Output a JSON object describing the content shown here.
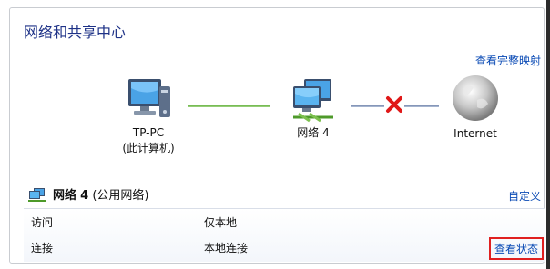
{
  "window": {
    "title": "网络和共享中心"
  },
  "map": {
    "full_map_link": "查看完整映射",
    "nodes": [
      {
        "label_line1": "TP-PC",
        "label_line2": "(此计算机)"
      },
      {
        "label_line1": "网络  4"
      },
      {
        "label_line1": "Internet"
      }
    ],
    "connection_status": {
      "pc_to_network": "connected",
      "network_to_internet": "disconnected"
    }
  },
  "active_network": {
    "name": "网络",
    "number": "4",
    "type": "(公用网络)",
    "customize_link": "自定义",
    "rows": [
      {
        "key": "访问",
        "value": "仅本地"
      },
      {
        "key": "连接",
        "value": "本地连接",
        "link": "查看状态"
      }
    ]
  },
  "colors": {
    "link": "#0b4bb5",
    "title": "#1e3287",
    "highlight_box": "#e02020"
  }
}
